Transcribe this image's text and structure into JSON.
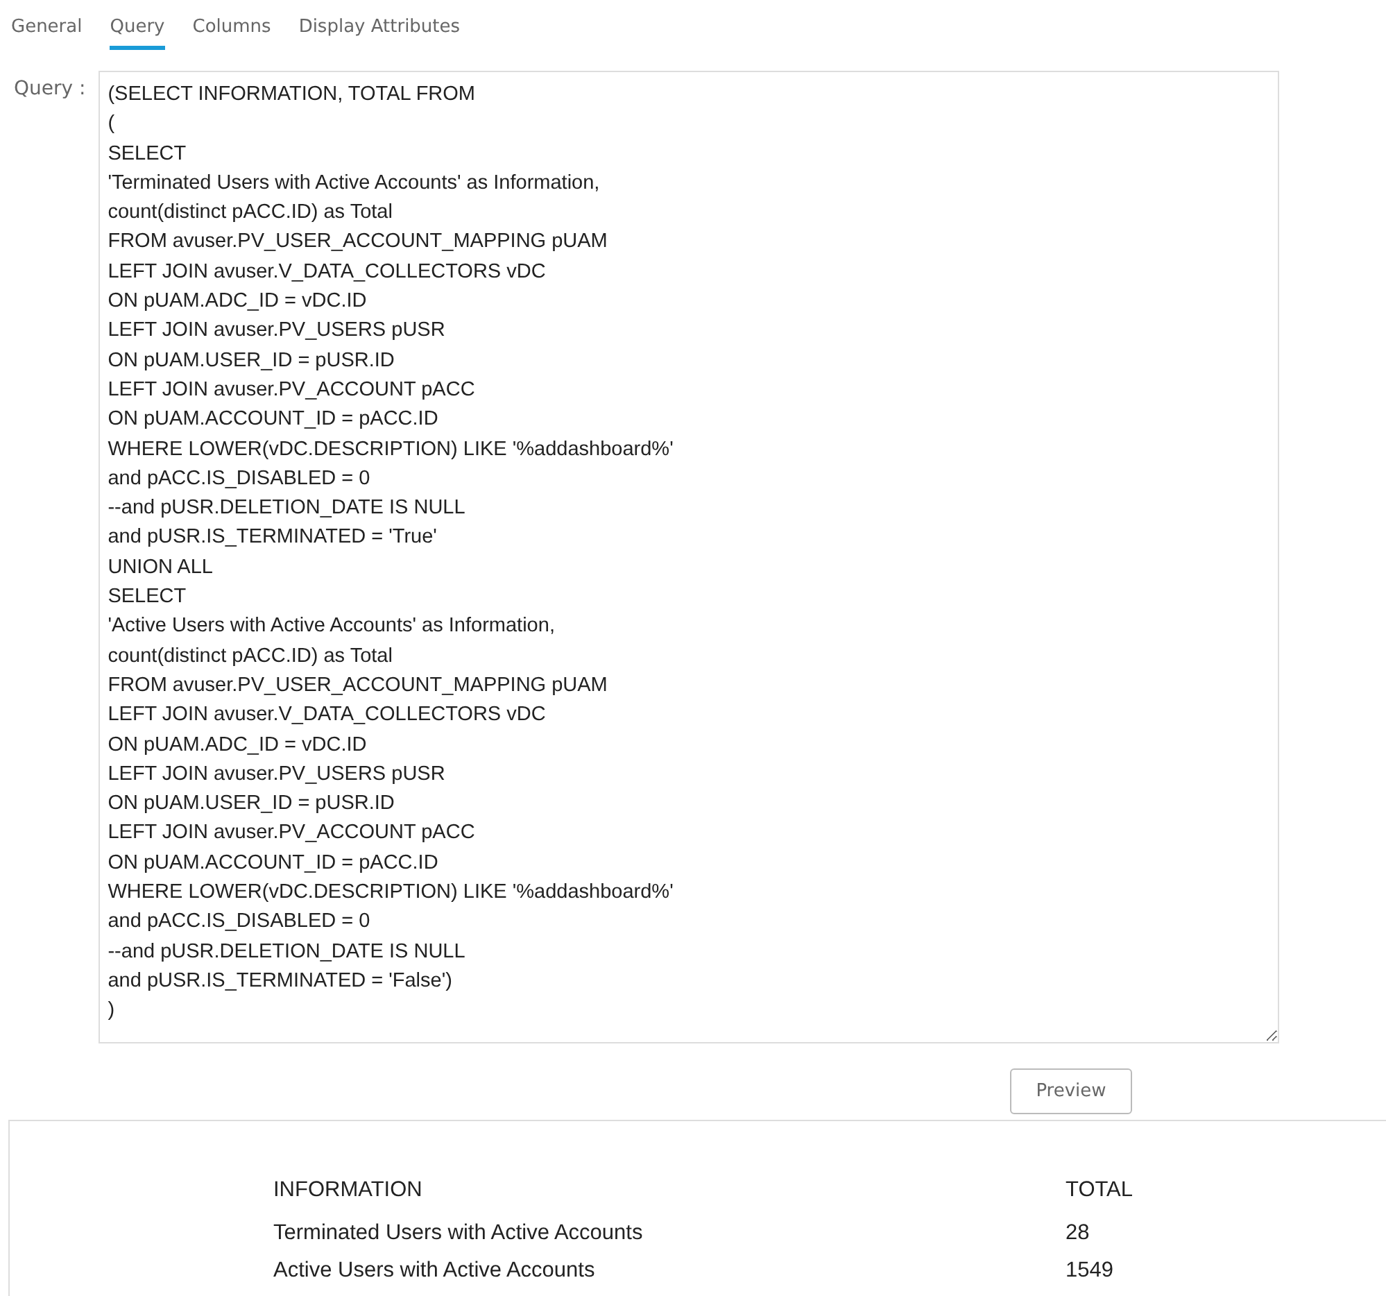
{
  "tabs": [
    {
      "label": "General",
      "selected": false
    },
    {
      "label": "Query",
      "selected": true
    },
    {
      "label": "Columns",
      "selected": false
    },
    {
      "label": "Display Attributes",
      "selected": false
    }
  ],
  "query": {
    "label": "Query :",
    "value": "(SELECT INFORMATION, TOTAL FROM\n(\nSELECT\n'Terminated Users with Active Accounts' as Information,\ncount(distinct pACC.ID) as Total\nFROM avuser.PV_USER_ACCOUNT_MAPPING pUAM\nLEFT JOIN avuser.V_DATA_COLLECTORS vDC\nON pUAM.ADC_ID = vDC.ID\nLEFT JOIN avuser.PV_USERS pUSR\nON pUAM.USER_ID = pUSR.ID\nLEFT JOIN avuser.PV_ACCOUNT pACC\nON pUAM.ACCOUNT_ID = pACC.ID\nWHERE LOWER(vDC.DESCRIPTION) LIKE '%addashboard%'\nand pACC.IS_DISABLED = 0\n--and pUSR.DELETION_DATE IS NULL\nand pUSR.IS_TERMINATED = 'True'\nUNION ALL\nSELECT\n'Active Users with Active Accounts' as Information,\ncount(distinct pACC.ID) as Total\nFROM avuser.PV_USER_ACCOUNT_MAPPING pUAM\nLEFT JOIN avuser.V_DATA_COLLECTORS vDC\nON pUAM.ADC_ID = vDC.ID\nLEFT JOIN avuser.PV_USERS pUSR\nON pUAM.USER_ID = pUSR.ID\nLEFT JOIN avuser.PV_ACCOUNT pACC\nON pUAM.ACCOUNT_ID = pACC.ID\nWHERE LOWER(vDC.DESCRIPTION) LIKE '%addashboard%'\nand pACC.IS_DISABLED = 0\n--and pUSR.DELETION_DATE IS NULL\nand pUSR.IS_TERMINATED = 'False')\n)"
  },
  "preview_button": "Preview",
  "results": {
    "columns": [
      "INFORMATION",
      "TOTAL"
    ],
    "rows": [
      [
        "Terminated Users with Active Accounts",
        "28"
      ],
      [
        "Active Users with Active Accounts",
        "1549"
      ]
    ]
  }
}
